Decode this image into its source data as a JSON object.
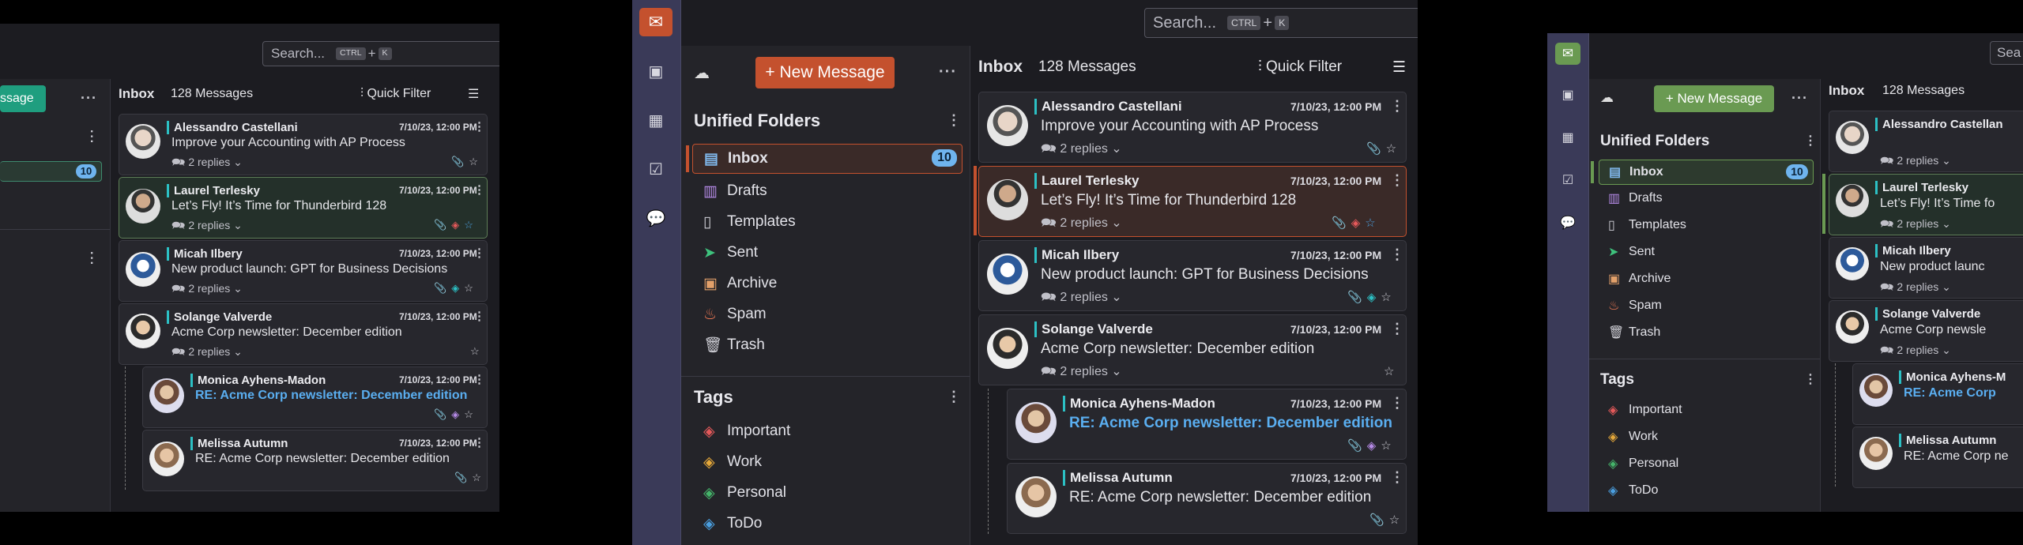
{
  "search": {
    "placeholder": "Search...",
    "key1": "CTRL",
    "plus": "+",
    "key2": "K"
  },
  "new_message": "+ New Message",
  "new_message_partial": "ssage",
  "new_message_label": "New Message",
  "folders_title": "Unified Folders",
  "folders": [
    {
      "label": "Inbox",
      "icon": "inbox-icon",
      "count": "10",
      "color": "#7fb6ea"
    },
    {
      "label": "Drafts",
      "icon": "drafts-icon",
      "color": "#b58ae6"
    },
    {
      "label": "Templates",
      "icon": "templates-icon",
      "color": "#cfcfd6"
    },
    {
      "label": "Sent",
      "icon": "sent-icon",
      "color": "#3ec27d"
    },
    {
      "label": "Archive",
      "icon": "archive-icon",
      "color": "#e2a06a"
    },
    {
      "label": "Spam",
      "icon": "spam-icon",
      "color": "#f07a55"
    },
    {
      "label": "Trash",
      "icon": "trash-icon",
      "color": "#cfcfd6"
    }
  ],
  "tags_title": "Tags",
  "tags": [
    {
      "label": "Important",
      "color": "#e4595a"
    },
    {
      "label": "Work",
      "color": "#e5a83a"
    },
    {
      "label": "Personal",
      "color": "#45b46a"
    },
    {
      "label": "ToDo",
      "color": "#4a9fe0"
    }
  ],
  "list": {
    "title": "Inbox",
    "count": "128 Messages",
    "quick_filter": "Quick Filter"
  },
  "messages": [
    {
      "sender": "Alessandro Castellani",
      "date": "7/10/23, 12:00 PM",
      "subject": "Improve your Accounting with AP Process",
      "replies": "2 replies"
    },
    {
      "sender": "Laurel Terlesky",
      "date": "7/10/23, 12:00 PM",
      "subject": "Let’s Fly! It’s Time for Thunderbird 128",
      "replies": "2 replies"
    },
    {
      "sender": "Micah Ilbery",
      "date": "7/10/23, 12:00 PM",
      "subject": "New product launch: GPT for Business Decisions",
      "replies": "2 replies"
    },
    {
      "sender": "Solange Valverde",
      "date": "7/10/23, 12:00 PM",
      "subject": "Acme Corp newsletter: December edition",
      "replies": "2 replies"
    },
    {
      "sender": "Monica Ayhens-Madon",
      "date": "7/10/23, 12:00 PM",
      "subject": "RE: Acme Corp newsletter: December edition",
      "replies": ""
    },
    {
      "sender": "Melissa Autumn",
      "date": "7/10/23, 12:00 PM",
      "subject": "RE: Acme Corp newsletter: December edition",
      "replies": ""
    }
  ],
  "right_partial": {
    "search": "Sea",
    "m0": "Alessandro Castellan",
    "m1": "Laurel Terlesky",
    "m1s": "Let’s Fly! It’s Time fo",
    "m2": "Micah Ilbery",
    "m2s": "New product launc",
    "m3": "Solange Valverde",
    "m3s": "Acme Corp newsle",
    "m4": "Monica Ayhens-M",
    "m4s": "RE: Acme Corp",
    "m5": "Melissa Autumn",
    "m5s": "RE: Acme Corp ne"
  },
  "colors": {
    "orange_accent": "#c4512e",
    "green_accent": "#6a9a52",
    "teal_accent": "#1f9e7f",
    "badge": "#6fb4ee"
  }
}
